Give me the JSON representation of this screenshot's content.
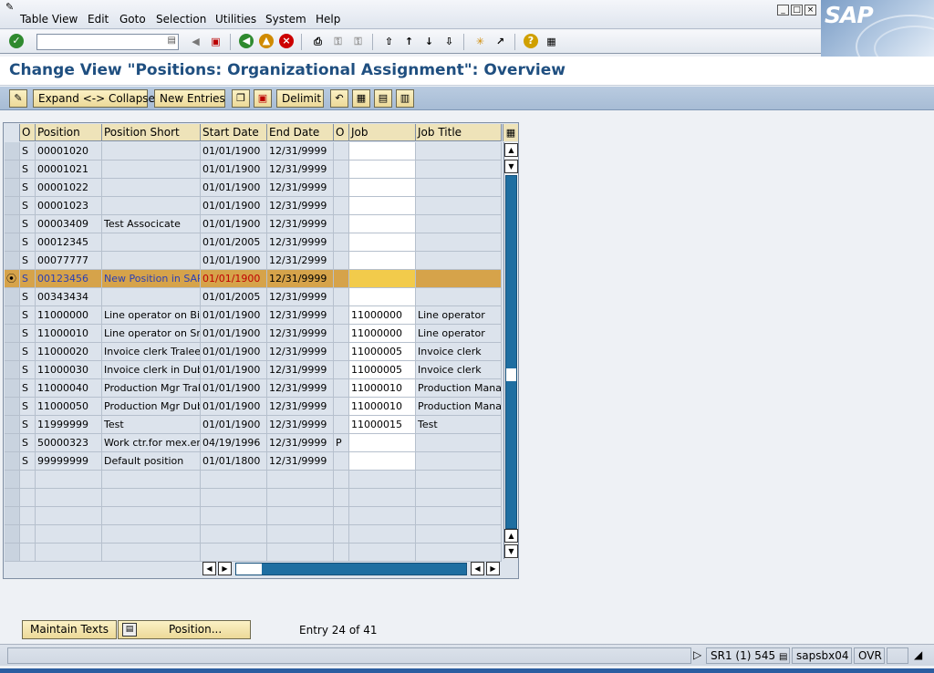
{
  "menu": {
    "items": [
      "Table View",
      "Edit",
      "Goto",
      "Selection",
      "Utilities",
      "System",
      "Help"
    ]
  },
  "logo": "SAP",
  "toolbar": {
    "command_field": "",
    "icons": [
      "enter-icon",
      "back-arrow-icon",
      "save-icon",
      "back-icon",
      "exit-icon",
      "cancel-icon",
      "print-icon",
      "find-icon",
      "find-next-icon",
      "first-page-icon",
      "previous-page-icon",
      "next-page-icon",
      "last-page-icon",
      "create-session-icon",
      "shortcut-icon",
      "help-icon",
      "layout-icon"
    ]
  },
  "title": "Change View \"Positions: Organizational Assignment\": Overview",
  "app_toolbar": {
    "expand_collapse": "Expand <-> Collapse",
    "new_entries": "New Entries",
    "delimit": "Delimit"
  },
  "table": {
    "columns": [
      "O",
      "Position",
      "Position Short",
      "Start Date",
      "End Date",
      "O",
      "Job",
      "Job Title"
    ],
    "rows": [
      {
        "o": "S",
        "position": "00001020",
        "short": "",
        "start": "01/01/1900",
        "end": "12/31/9999",
        "o2": "",
        "job": "",
        "title": ""
      },
      {
        "o": "S",
        "position": "00001021",
        "short": "",
        "start": "01/01/1900",
        "end": "12/31/9999",
        "o2": "",
        "job": "",
        "title": ""
      },
      {
        "o": "S",
        "position": "00001022",
        "short": "",
        "start": "01/01/1900",
        "end": "12/31/9999",
        "o2": "",
        "job": "",
        "title": ""
      },
      {
        "o": "S",
        "position": "00001023",
        "short": "",
        "start": "01/01/1900",
        "end": "12/31/9999",
        "o2": "",
        "job": "",
        "title": ""
      },
      {
        "o": "S",
        "position": "00003409",
        "short": "Test Associcate",
        "start": "01/01/1900",
        "end": "12/31/9999",
        "o2": "",
        "job": "",
        "title": ""
      },
      {
        "o": "S",
        "position": "00012345",
        "short": "",
        "start": "01/01/2005",
        "end": "12/31/9999",
        "o2": "",
        "job": "",
        "title": ""
      },
      {
        "o": "S",
        "position": "00077777",
        "short": "",
        "start": "01/01/1900",
        "end": "12/31/2999",
        "o2": "",
        "job": "",
        "title": ""
      },
      {
        "o": "S",
        "position": "00123456",
        "short": "New Position in SAP",
        "start": "01/01/1900",
        "end": "12/31/9999",
        "o2": "",
        "job": "",
        "title": ""
      },
      {
        "o": "S",
        "position": "00343434",
        "short": "",
        "start": "01/01/2005",
        "end": "12/31/9999",
        "o2": "",
        "job": "",
        "title": ""
      },
      {
        "o": "S",
        "position": "11000000",
        "short": "Line operator on Big",
        "start": "01/01/1900",
        "end": "12/31/9999",
        "o2": "",
        "job": "11000000",
        "title": "Line operator"
      },
      {
        "o": "S",
        "position": "11000010",
        "short": "Line operator on Sm",
        "start": "01/01/1900",
        "end": "12/31/9999",
        "o2": "",
        "job": "11000000",
        "title": "Line operator"
      },
      {
        "o": "S",
        "position": "11000020",
        "short": "Invoice clerk Tralee",
        "start": "01/01/1900",
        "end": "12/31/9999",
        "o2": "",
        "job": "11000005",
        "title": "Invoice clerk"
      },
      {
        "o": "S",
        "position": "11000030",
        "short": "Invoice clerk in Dub",
        "start": "01/01/1900",
        "end": "12/31/9999",
        "o2": "",
        "job": "11000005",
        "title": "Invoice clerk"
      },
      {
        "o": "S",
        "position": "11000040",
        "short": "Production Mgr Tral",
        "start": "01/01/1900",
        "end": "12/31/9999",
        "o2": "",
        "job": "11000010",
        "title": "Production Mana"
      },
      {
        "o": "S",
        "position": "11000050",
        "short": "Production Mgr Dub",
        "start": "01/01/1900",
        "end": "12/31/9999",
        "o2": "",
        "job": "11000010",
        "title": "Production Mana"
      },
      {
        "o": "S",
        "position": "11999999",
        "short": "Test",
        "start": "01/01/1900",
        "end": "12/31/9999",
        "o2": "",
        "job": "11000015",
        "title": "Test"
      },
      {
        "o": "S",
        "position": "50000323",
        "short": "Work ctr.for mex.em",
        "start": "04/19/1996",
        "end": "12/31/9999",
        "o2": "P",
        "job": "",
        "title": ""
      },
      {
        "o": "S",
        "position": "99999999",
        "short": "Default position",
        "start": "01/01/1800",
        "end": "12/31/9999",
        "o2": "",
        "job": "",
        "title": ""
      }
    ],
    "empty_rows": 5,
    "active_row_index": 7
  },
  "footer": {
    "maintain_texts": "Maintain Texts",
    "position_button": "Position...",
    "entry_info": "Entry 24 of 41"
  },
  "status": {
    "system": "SR1 (1) 545",
    "server": "sapsbx04",
    "mode": "OVR"
  }
}
